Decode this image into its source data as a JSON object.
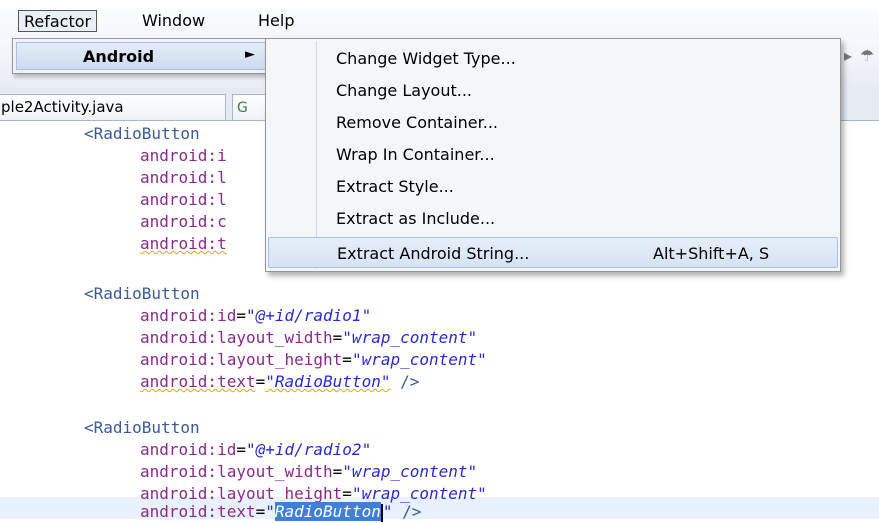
{
  "menubar": {
    "items": [
      "Refactor",
      "Window",
      "Help"
    ]
  },
  "toolbar": {
    "glyphs": [
      "▸",
      "☂"
    ]
  },
  "tabs": {
    "java_label": "ple2Activity.java",
    "xml_icon": "G"
  },
  "refactor_menu": {
    "item_label": "Android",
    "submenu_arrow": "►"
  },
  "android_submenu": {
    "items": [
      {
        "label": "Change Widget Type...",
        "shortcut": ""
      },
      {
        "label": "Change Layout...",
        "shortcut": ""
      },
      {
        "label": "Remove Container...",
        "shortcut": ""
      },
      {
        "label": "Wrap In Container...",
        "shortcut": ""
      },
      {
        "label": "Extract Style...",
        "shortcut": ""
      },
      {
        "label": "Extract as Include...",
        "shortcut": ""
      },
      {
        "label": "Extract Android String...",
        "shortcut": "Alt+Shift+A, S"
      }
    ],
    "highlighted_index": 6
  },
  "code": {
    "block1": {
      "tag": "<RadioButton",
      "attrs": [
        "android:i",
        "android:l",
        "android:l",
        "android:c",
        "android:t"
      ]
    },
    "block2": {
      "tag": "<RadioButton",
      "id_attr": "android:id",
      "id_val": "\"@+id/radio1\"",
      "w_attr": "android:layout_width",
      "w_val": "\"wrap_content\"",
      "h_attr": "android:layout_height",
      "h_val": "\"wrap_content\"",
      "t_attr": "android:text",
      "t_val": "\"RadioButton\"",
      "close": " />"
    },
    "block3": {
      "tag": "<RadioButton",
      "id_attr": "android:id",
      "id_val": "\"@+id/radio2\"",
      "w_attr": "android:layout_width",
      "w_val": "\"wrap_content\"",
      "h_attr": "android:layout_height",
      "h_val": "\"wrap_content\"",
      "t_attr": "android:text",
      "t_open": "\"",
      "t_sel": "RadioButton",
      "t_close": "\"",
      "close": " />"
    }
  },
  "colors": {
    "tag": "#3b5a99",
    "attr": "#8b2a8b",
    "value": "#2a2ad0",
    "selection": "#3f7fd9",
    "menu_highlight": "#d6e3f3"
  }
}
